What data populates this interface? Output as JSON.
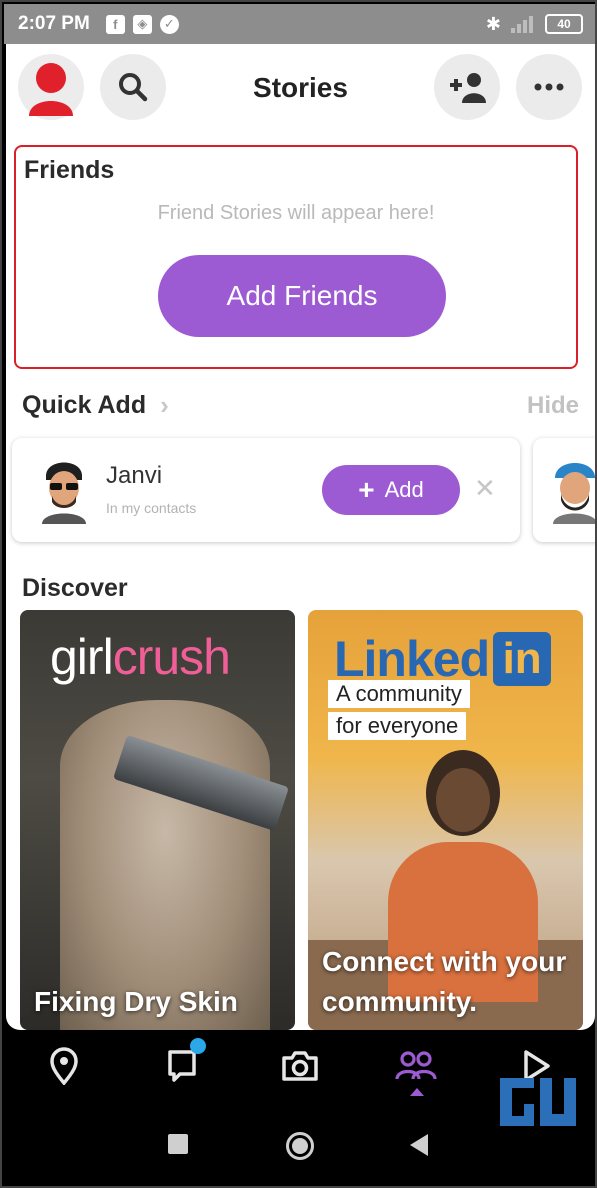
{
  "status_bar": {
    "time": "2:07 PM",
    "battery": "40"
  },
  "header": {
    "title": "Stories"
  },
  "friends": {
    "title": "Friends",
    "empty_text": "Friend Stories will appear here!",
    "add_button": "Add Friends"
  },
  "quick_add": {
    "title": "Quick Add",
    "hide_label": "Hide",
    "items": [
      {
        "name": "Janvi",
        "subtitle": "In my contacts",
        "add_label": "Add"
      }
    ]
  },
  "discover": {
    "title": "Discover",
    "tiles": [
      {
        "brand_part1": "girl",
        "brand_part2": "crush",
        "title": "Fixing Dry Skin"
      },
      {
        "brand_text": "Linked",
        "brand_box": "in",
        "tag1": "A community",
        "tag2": "for everyone",
        "title": "Connect with your community."
      }
    ]
  },
  "colors": {
    "accent_purple": "#9C5BD3",
    "highlight_red": "#D8202A",
    "chat_dot": "#2AA8E8",
    "linkedin_blue": "#2867B2"
  }
}
